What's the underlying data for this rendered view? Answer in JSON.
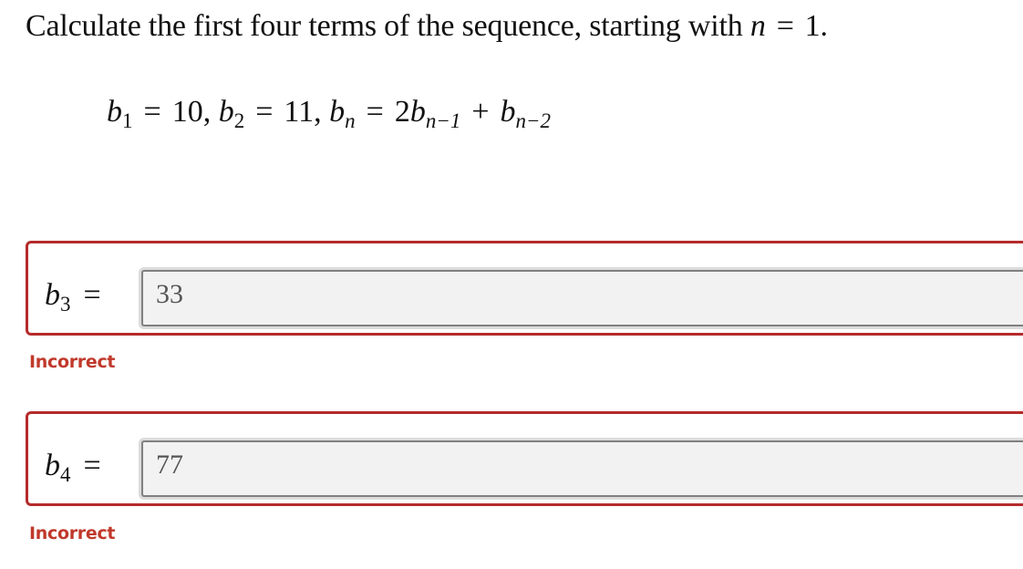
{
  "prompt": {
    "text_before": "Calculate the first four terms of the sequence, starting with",
    "variable": "n",
    "equals": "=",
    "value": "1."
  },
  "formula": {
    "b": "b",
    "sub1": "1",
    "eq": "=",
    "val1": "10,",
    "sub2": "2",
    "val2": "11,",
    "subn": "n",
    "rhs_coef": "2",
    "sub_nm1": "n−1",
    "plus": "+",
    "sub_nm2": "n−2"
  },
  "questions": [
    {
      "label_var": "b",
      "label_sub": "3",
      "equals": "=",
      "value": "33",
      "feedback": "Incorrect"
    },
    {
      "label_var": "b",
      "label_sub": "4",
      "equals": "=",
      "value": "77",
      "feedback": "Incorrect"
    }
  ],
  "colors": {
    "incorrect": "#c0392b",
    "box_border": "#b52b2b"
  }
}
